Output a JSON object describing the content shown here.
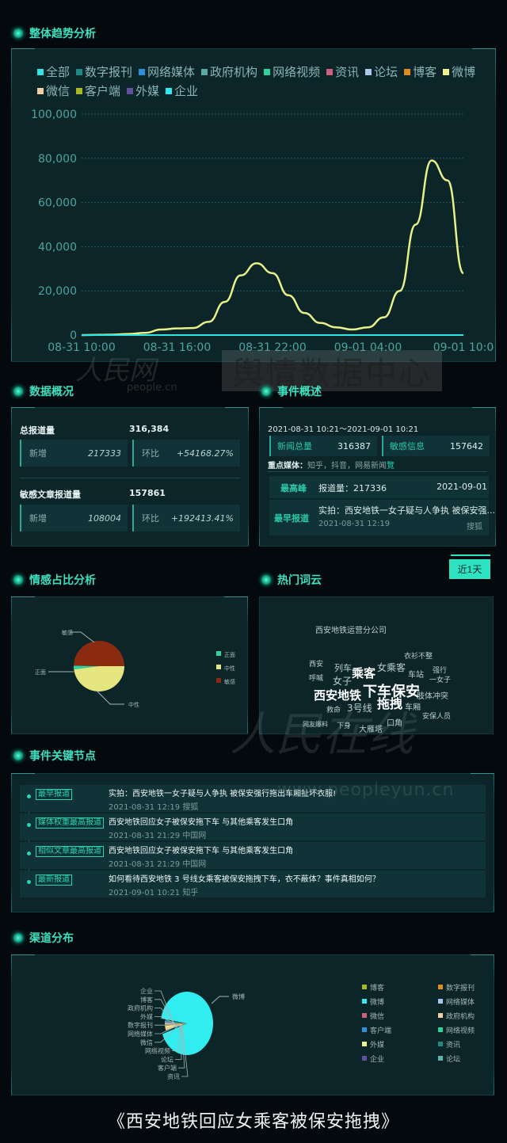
{
  "sections": {
    "trend": "整体趋势分析",
    "overview": "数据概况",
    "event_summary": "事件概述",
    "sentiment": "情感占比分析",
    "wordcloud": "热门词云",
    "key_nodes": "事件关键节点",
    "channels": "渠道分布"
  },
  "trend_legend": [
    {
      "label": "全部",
      "color": "#2ee6e6"
    },
    {
      "label": "数字报刊",
      "color": "#1a8a86"
    },
    {
      "label": "网络媒体",
      "color": "#2a8fe0"
    },
    {
      "label": "政府机构",
      "color": "#5aa8a8"
    },
    {
      "label": "网络视频",
      "color": "#2ad49a"
    },
    {
      "label": "资讯",
      "color": "#d06080"
    },
    {
      "label": "论坛",
      "color": "#a8c8f0"
    },
    {
      "label": "博客",
      "color": "#e08a20"
    },
    {
      "label": "微博",
      "color": "#f0f08a"
    },
    {
      "label": "微信",
      "color": "#f0d0a0"
    },
    {
      "label": "客户端",
      "color": "#a8b820"
    },
    {
      "label": "外媒",
      "color": "#6050a0"
    },
    {
      "label": "企业",
      "color": "#30e8f0"
    }
  ],
  "chart_data": [
    {
      "type": "line",
      "title": "整体趋势分析",
      "xlabel": "",
      "ylabel": "",
      "ylim": [
        0,
        100000
      ],
      "yticks": [
        "0",
        "20,000",
        "40,000",
        "60,000",
        "80,000",
        "100,000"
      ],
      "xticks": [
        "08-31 10:00",
        "08-31 16:00",
        "08-31 22:00",
        "09-01 04:00",
        "09-01 10:0"
      ],
      "x_hours": [
        0,
        1,
        2,
        3,
        4,
        5,
        6,
        7,
        8,
        9,
        10,
        11,
        12,
        13,
        14,
        15,
        16,
        17,
        18,
        19,
        20,
        21,
        22,
        23,
        24
      ],
      "series": [
        {
          "name": "微博",
          "color": "#e8f08a",
          "values": [
            0,
            100,
            200,
            500,
            1000,
            2500,
            3000,
            3200,
            6000,
            15000,
            27000,
            32500,
            28000,
            18000,
            10000,
            5500,
            3500,
            2500,
            3500,
            8000,
            20000,
            50000,
            79000,
            70000,
            28000
          ]
        },
        {
          "name": "全部",
          "color": "#2ee6e6",
          "values": [
            0,
            0,
            0,
            0,
            0,
            0,
            0,
            0,
            0,
            0,
            0,
            0,
            0,
            0,
            0,
            0,
            0,
            0,
            0,
            0,
            0,
            0,
            0,
            0,
            0
          ]
        }
      ],
      "grid": true,
      "legend": "top"
    },
    {
      "type": "pie",
      "title": "情感占比分析",
      "categories": [
        "正面",
        "中性",
        "敏感"
      ],
      "values": [
        2,
        48,
        50
      ],
      "colors": [
        "#2ad4a8",
        "#e6e680",
        "#8a2a10"
      ],
      "legend": "right"
    },
    {
      "type": "pie",
      "title": "渠道分布",
      "categories": [
        "微博",
        "企业",
        "博客",
        "政府机构",
        "外媒",
        "数字报刊",
        "网络媒体",
        "微信",
        "网络视频",
        "论坛",
        "客户端",
        "资讯"
      ],
      "values": [
        92,
        0.3,
        0.3,
        1.5,
        1.5,
        1.2,
        1.0,
        0.6,
        0.5,
        0.4,
        0.4,
        0.3
      ],
      "colors": [
        "#30eef0",
        "#6050a0",
        "#a8b820",
        "#f0d0a0",
        "#f0f08a",
        "#e08a20",
        "#a8c8f0",
        "#d06080",
        "#2ad49a",
        "#5ab8b0",
        "#2a8fe0",
        "#1a8a86"
      ],
      "legend": "right"
    }
  ],
  "overview": {
    "total_label": "总报道量",
    "total_value": "316,384",
    "total_new_label": "新增",
    "total_new_value": "217333",
    "total_ratio_label": "环比",
    "total_ratio_value": "+54168.27%",
    "sensitive_label": "敏感文章报道量",
    "sensitive_value": "157861",
    "sensitive_new_label": "新增",
    "sensitive_new_value": "108004",
    "sensitive_ratio_label": "环比",
    "sensitive_ratio_value": "+192413.41%"
  },
  "event_summary": {
    "range": "2021-08-31 10:21～2021-09-01 10:21",
    "news_total_label": "新闻总量",
    "news_total_value": "316387",
    "sensitive_label": "敏感信息",
    "sensitive_value": "157642",
    "key_media_label": "重点媒体：",
    "key_media_value": "知乎，抖音，网易新闻",
    "more_glyph": "覽",
    "peak_tag": "最高峰",
    "peak_text": "报道量：217336",
    "peak_date": "2021-09-01",
    "earliest_tag": "最早报道",
    "earliest_title": "实拍：西安地铁一女子疑与人争执 被保安强...",
    "earliest_time": "2021-08-31 12:19",
    "earliest_source": "搜狐"
  },
  "range_button": "近1天",
  "wordcloud": [
    {
      "text": "西安地铁运营分公司",
      "size": 10
    },
    {
      "text": "衣衫不整",
      "size": 9
    },
    {
      "text": "西安",
      "size": 9
    },
    {
      "text": "列车",
      "size": 11
    },
    {
      "text": "女乘客",
      "size": 12
    },
    {
      "text": "车站",
      "size": 10
    },
    {
      "text": "强行",
      "size": 9
    },
    {
      "text": "乘客",
      "size": 15
    },
    {
      "text": "呼喊",
      "size": 9
    },
    {
      "text": "女子",
      "size": 12
    },
    {
      "text": "一女子",
      "size": 9
    },
    {
      "text": "下车保安",
      "size": 18
    },
    {
      "text": "西安地铁",
      "size": 15
    },
    {
      "text": "肢体冲突",
      "size": 10
    },
    {
      "text": "拖拽",
      "size": 16
    },
    {
      "text": "救命",
      "size": 9
    },
    {
      "text": "3号线",
      "size": 12
    },
    {
      "text": "车厢",
      "size": 10
    },
    {
      "text": "安保人员",
      "size": 9
    },
    {
      "text": "口角",
      "size": 10
    },
    {
      "text": "网友爆料",
      "size": 8
    },
    {
      "text": "下身",
      "size": 9
    },
    {
      "text": "大雁塔",
      "size": 10
    }
  ],
  "key_nodes": [
    {
      "tag": "最早报道",
      "title": "实拍：西安地铁一女子疑与人争执 被保安强行拖出车厢扯坏衣服!",
      "time": "2021-08-31 12:19",
      "source": "搜狐"
    },
    {
      "tag": "媒体权重最高报道",
      "title": "西安地铁回应女子被保安拖下车 与其他乘客发生口角",
      "time": "2021-08-31 21:29",
      "source": "中国网"
    },
    {
      "tag": "相似文章最高报道",
      "title": "西安地铁回应女子被保安拖下车 与其他乘客发生口角",
      "time": "2021-08-31 21:29",
      "source": "中国网"
    },
    {
      "tag": "最新报道",
      "title": "如何看待西安地铁 3 号线女乘客被保安拖拽下车，衣不蔽体？事件真相如何？",
      "time": "2021-09-01 10:21",
      "source": "知乎"
    }
  ],
  "channel_legend": [
    {
      "label": "博客",
      "color": "#a8b820"
    },
    {
      "label": "数字报刊",
      "color": "#e08a20"
    },
    {
      "label": "微博",
      "color": "#30eef0"
    },
    {
      "label": "网络媒体",
      "color": "#a8c8f0"
    },
    {
      "label": "微信",
      "color": "#d06080"
    },
    {
      "label": "政府机构",
      "color": "#f0d0a0"
    },
    {
      "label": "客户端",
      "color": "#2a8fe0"
    },
    {
      "label": "网络视频",
      "color": "#2ad49a"
    },
    {
      "label": "外媒",
      "color": "#f0f08a"
    },
    {
      "label": "资讯",
      "color": "#1a8a86"
    },
    {
      "label": "企业",
      "color": "#6050a0"
    },
    {
      "label": "论坛",
      "color": "#5ab8b0"
    }
  ],
  "watermarks": {
    "logo": "人民网",
    "logo_sub": "people.cn",
    "center": "舆情数据中心",
    "mid": "人民在线",
    "url": "www.peopleyun.cn"
  },
  "footer_title": "《西安地铁回应女乘客被保安拖拽》"
}
